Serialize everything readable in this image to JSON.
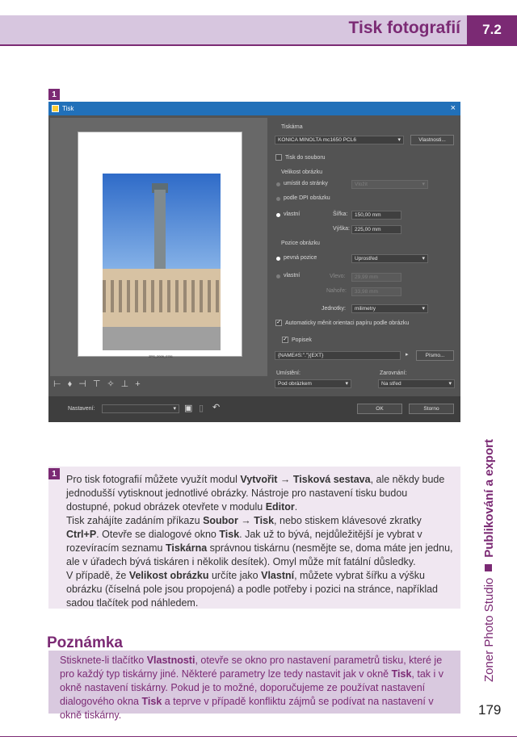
{
  "header": {
    "title": "Tisk fotografií",
    "section_number": "7.2"
  },
  "side": {
    "left_text": "Zoner Photo Studio",
    "right_text": "Publikování a export"
  },
  "figure_badge": "1",
  "dialog": {
    "title": "Tisk",
    "close_symbol": "×",
    "preview_caption": "ZPS_2009_0781",
    "toolbar_icons": [
      "align-left-icon",
      "align-center-icon",
      "align-right-icon",
      "align-top-icon",
      "align-middle-icon",
      "align-bottom-icon",
      "crosshair-icon"
    ],
    "printer": {
      "section_label": "Tiskárna",
      "printer_name": "KONICA MINOLTA mc1650 PCL6",
      "properties_button": "Vlastnosti...",
      "print_to_file": "Tisk do souboru"
    },
    "image_size": {
      "section_label": "Velikost obrázku",
      "opt_fit_page": "umístit do stránky",
      "fit_value": "Vložit",
      "opt_dpi": "podle DPI obrázku",
      "opt_custom": "vlastní",
      "width_label": "Šířka:",
      "width_value": "150,00 mm",
      "height_label": "Výška:",
      "height_value": "225,00 mm"
    },
    "image_position": {
      "section_label": "Pozice obrázku",
      "opt_fixed": "pevná pozice",
      "fixed_value": "Uprostřed",
      "opt_custom": "vlastní",
      "left_label": "Vlevo:",
      "left_value": "29,99 mm",
      "top_label": "Nahoře:",
      "top_value": "33,98 mm",
      "units_label": "Jednotky:",
      "units_value": "milimetry",
      "auto_orient": "Automaticky měnit orientaci papíru podle obrázku"
    },
    "caption": {
      "checkbox_label": "Popisek",
      "template": "{NAME#S:\".\"}{EXT}",
      "font_button": "Písmo...",
      "placement_label": "Umístění:",
      "placement_value": "Pod obrázkem",
      "align_label": "Zarovnání:",
      "align_value": "Na střed"
    },
    "footer": {
      "settings_label": "Nastavení:",
      "ok_button": "OK",
      "cancel_button": "Storno"
    }
  },
  "info": {
    "badge": "1",
    "p1": [
      {
        "t": "Pro tisk fotografií můžete využít modul "
      },
      {
        "b": "Vytvořit → Tisková sestava"
      },
      {
        "t": ", ale někdy bude jednodušší vytisknout jednotlivé obrázky. Nástroje pro nastavení tisku budou dostupné, pokud obrázek otevřete v modulu "
      },
      {
        "b": "Editor"
      },
      {
        "t": "."
      }
    ],
    "p2": [
      {
        "t": "Tisk zahájíte zadáním příkazu "
      },
      {
        "b": "Soubor → Tisk"
      },
      {
        "t": ", nebo stiskem klávesové zkratky "
      },
      {
        "b": "Ctrl+P"
      },
      {
        "t": ". Otevře se dialogové okno "
      },
      {
        "b": "Tisk"
      },
      {
        "t": ". Jak už to bývá, nejdůležitější je vybrat v rozevíracím seznamu "
      },
      {
        "b": "Tiskárna"
      },
      {
        "t": " správnou tiskárnu (nesmějte se, doma máte jen jednu, ale v úřadech bývá tiskáren i několik desítek). Omyl může mít fatální důsledky."
      }
    ],
    "p3": [
      {
        "t": "V případě, že "
      },
      {
        "b": "Velikost obrázku"
      },
      {
        "t": " určíte jako "
      },
      {
        "b": "Vlastní"
      },
      {
        "t": ", můžete vybrat šířku a výšku obrázku (číselná pole jsou propojená) a podle potřeby i pozici na stránce, například sadou tlačítek pod náhledem."
      }
    ]
  },
  "note": {
    "title": "Poznámka",
    "body": [
      {
        "t": "Stisknete-li tlačítko "
      },
      {
        "b": "Vlastnosti"
      },
      {
        "t": ", otevře se okno pro nastavení parametrů tisku, které je pro každý typ tiskárny jiné. Některé parametry lze tedy nastavit jak v okně "
      },
      {
        "b": "Tisk"
      },
      {
        "t": ", tak i v okně nastavení tiskárny. Pokud je to možné, doporučujeme ze používat nastavení dialogového okna "
      },
      {
        "b": "Tisk"
      },
      {
        "t": " a teprve v případě konfliktu zájmů se podívat na nastavení v okně tiskárny."
      }
    ]
  },
  "page_number": "179"
}
